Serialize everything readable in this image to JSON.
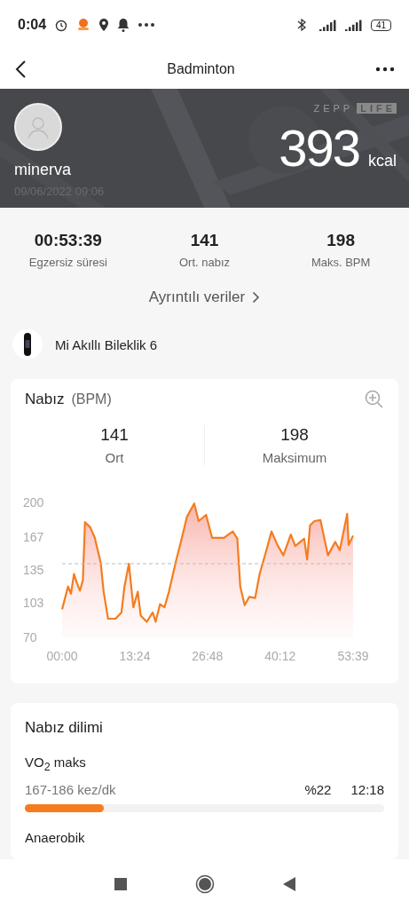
{
  "status_bar": {
    "time": "0:04",
    "battery": "41"
  },
  "header": {
    "title": "Badminton"
  },
  "hero": {
    "user_name": "minerva",
    "date": "09/06/2022 09:06",
    "logo": [
      "ZEPP",
      "LIFE"
    ],
    "calories": "393",
    "calories_unit": "kcal"
  },
  "stats": [
    {
      "value": "00:53:39",
      "label": "Egzersiz süresi"
    },
    {
      "value": "141",
      "label": "Ort. nabız"
    },
    {
      "value": "198",
      "label": "Maks. BPM"
    }
  ],
  "details_link": "Ayrıntılı veriler",
  "device": {
    "name": "Mi Akıllı Bileklik 6"
  },
  "heart_rate_card": {
    "title": "Nabız",
    "unit": "(BPM)",
    "summary": [
      {
        "value": "141",
        "label": "Ort"
      },
      {
        "value": "198",
        "label": "Maksimum"
      }
    ],
    "chart_data": {
      "type": "area",
      "x": [
        0,
        1.09,
        1.64,
        2.19,
        2.74,
        3.28,
        3.83,
        4.22,
        5.2,
        6.02,
        7.12,
        7.66,
        8.48,
        9.85,
        10.95,
        11.5,
        12.32,
        13.14,
        13.96,
        14.5,
        15.6,
        16.7,
        17.24,
        18.06,
        18.88,
        19.7,
        21.07,
        21.9,
        22.99,
        24.36,
        25.18,
        26.55,
        27.64,
        29.83,
        31.48,
        32.3,
        32.85,
        33.67,
        34.49,
        35.59,
        36.41,
        37.5,
        38.6,
        39.69,
        40.79,
        42.16,
        42.98,
        44.62,
        45.17,
        45.72,
        46.54,
        47.63,
        49.0,
        50.37,
        51.19,
        52.56,
        52.83,
        53.65
      ],
      "series": [
        {
          "color": "#f57c1f",
          "values": [
            97,
            119,
            112,
            131,
            122,
            115,
            125,
            181,
            176,
            166,
            142,
            114,
            88,
            88,
            94,
            119,
            141,
            99,
            114,
            91,
            85,
            94,
            85,
            102,
            99,
            114,
            145,
            162,
            186,
            199,
            182,
            188,
            166,
            166,
            172,
            165,
            119,
            101,
            109,
            108,
            131,
            151,
            172,
            159,
            149,
            169,
            158,
            165,
            145,
            178,
            182,
            183,
            149,
            162,
            154,
            189,
            159,
            168
          ]
        }
      ],
      "xlim": [
        0,
        53.65
      ],
      "ylim": [
        70,
        200
      ],
      "yticks": [
        70,
        103,
        135,
        167,
        200
      ],
      "xticks": [
        {
          "value": 0,
          "label": "00:00"
        },
        {
          "value": 13.4,
          "label": "13:24"
        },
        {
          "value": 26.8,
          "label": "26:48"
        },
        {
          "value": 40.2,
          "label": "40:12"
        },
        {
          "value": 53.65,
          "label": "53:39"
        }
      ],
      "ref_lines": [
        {
          "axis": "y",
          "value": 141
        }
      ]
    }
  },
  "zone_card": {
    "title": "Nabız dilimi",
    "zones": [
      {
        "name": "VO$_{2}$ maks",
        "range": "167-186 kez/dk",
        "percent": "%22",
        "time": "12:18",
        "level": 0.22
      },
      {
        "name": "Anaerobik"
      }
    ]
  }
}
